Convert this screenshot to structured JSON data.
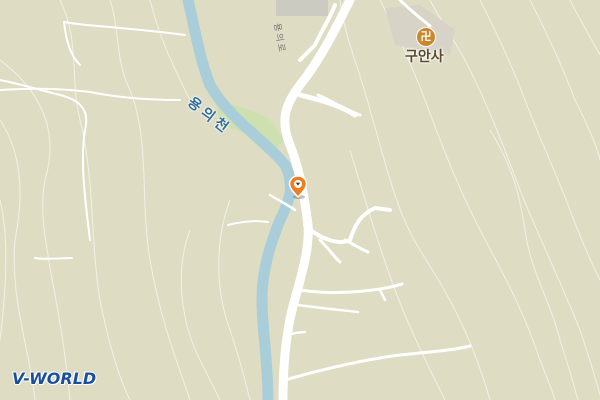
{
  "map": {
    "temple": {
      "label": "구안사",
      "icon": "temple-icon",
      "glyph": "卍"
    },
    "river": {
      "label": "용의천"
    },
    "road": {
      "label": "용의로"
    },
    "marker": {
      "icon": "location-pin-icon",
      "color": "#f07e1f"
    },
    "logo": {
      "text": "V-WORLD"
    },
    "colors": {
      "land": "#dedcc3",
      "contour": "#ffffff",
      "river": "#a9cdd9",
      "road": "#ffffff",
      "green": "#cfe0b0",
      "built": "#cbcbc2"
    }
  }
}
